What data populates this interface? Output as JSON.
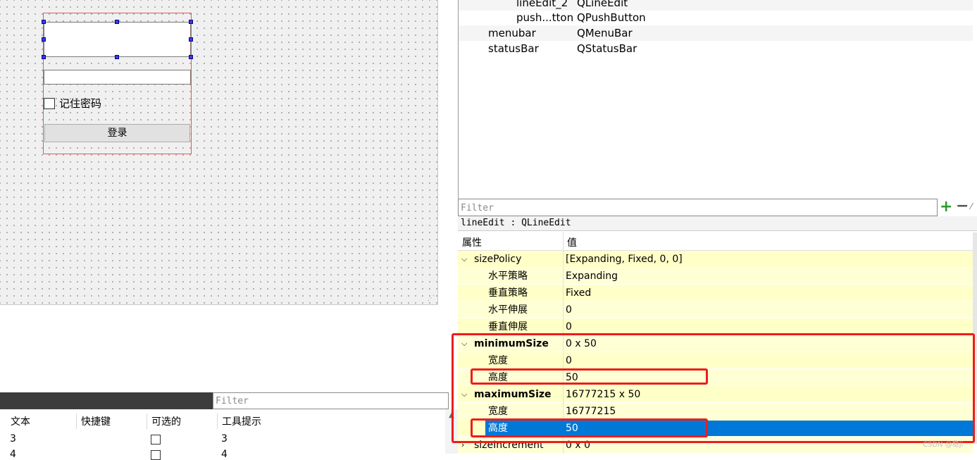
{
  "form": {
    "checkbox_label": "记住密码",
    "login_label": "登录"
  },
  "action_editor": {
    "filter_placeholder": "Filter",
    "columns": [
      "文本",
      "快捷键",
      "可选的",
      "工具提示"
    ],
    "rows": [
      {
        "text": "3",
        "tooltip": "3"
      },
      {
        "text": "4",
        "tooltip": "4"
      }
    ]
  },
  "object_inspector": {
    "rows": [
      {
        "name": "lineEdit_2",
        "class": "QLineEdit"
      },
      {
        "name": "push...tton",
        "class": "QPushButton"
      },
      {
        "name": "menubar",
        "class": "QMenuBar"
      },
      {
        "name": "statusBar",
        "class": "QStatusBar"
      }
    ]
  },
  "property_editor": {
    "filter_placeholder": "Filter",
    "object_label": "lineEdit : QLineEdit",
    "header": {
      "property": "属性",
      "value": "值"
    },
    "rows": [
      {
        "name": "sizePolicy",
        "value": "[Expanding, Fixed, 0, 0]",
        "group": true,
        "expanded": true
      },
      {
        "name": "水平策略",
        "value": "Expanding"
      },
      {
        "name": "垂直策略",
        "value": "Fixed"
      },
      {
        "name": "水平伸展",
        "value": "0"
      },
      {
        "name": "垂直伸展",
        "value": "0"
      },
      {
        "name": "minimumSize",
        "value": "0 x 50",
        "group": true,
        "expanded": true,
        "bold": true
      },
      {
        "name": "宽度",
        "value": "0"
      },
      {
        "name": "高度",
        "value": "50"
      },
      {
        "name": "maximumSize",
        "value": "16777215 x 50",
        "group": true,
        "expanded": true,
        "bold": true
      },
      {
        "name": "宽度",
        "value": "16777215"
      },
      {
        "name": "高度",
        "value": "50",
        "selected": true
      },
      {
        "name": "sizeIncrement",
        "value": "0 x 0",
        "group": true,
        "expanded": false
      }
    ]
  },
  "icons": {
    "add": "plus-icon",
    "remove": "minus-icon",
    "configure": "wrench-icon",
    "expanded": "chevron-down-icon",
    "collapsed": "chevron-right-icon"
  },
  "colors": {
    "selection": "#0078d7",
    "property_row": "#ffffd0",
    "annotation": "#ee1c1c",
    "selection_frame": "#e05a5a",
    "handle": "#3b3bdf"
  },
  "watermark": "CSDN @稳ji"
}
